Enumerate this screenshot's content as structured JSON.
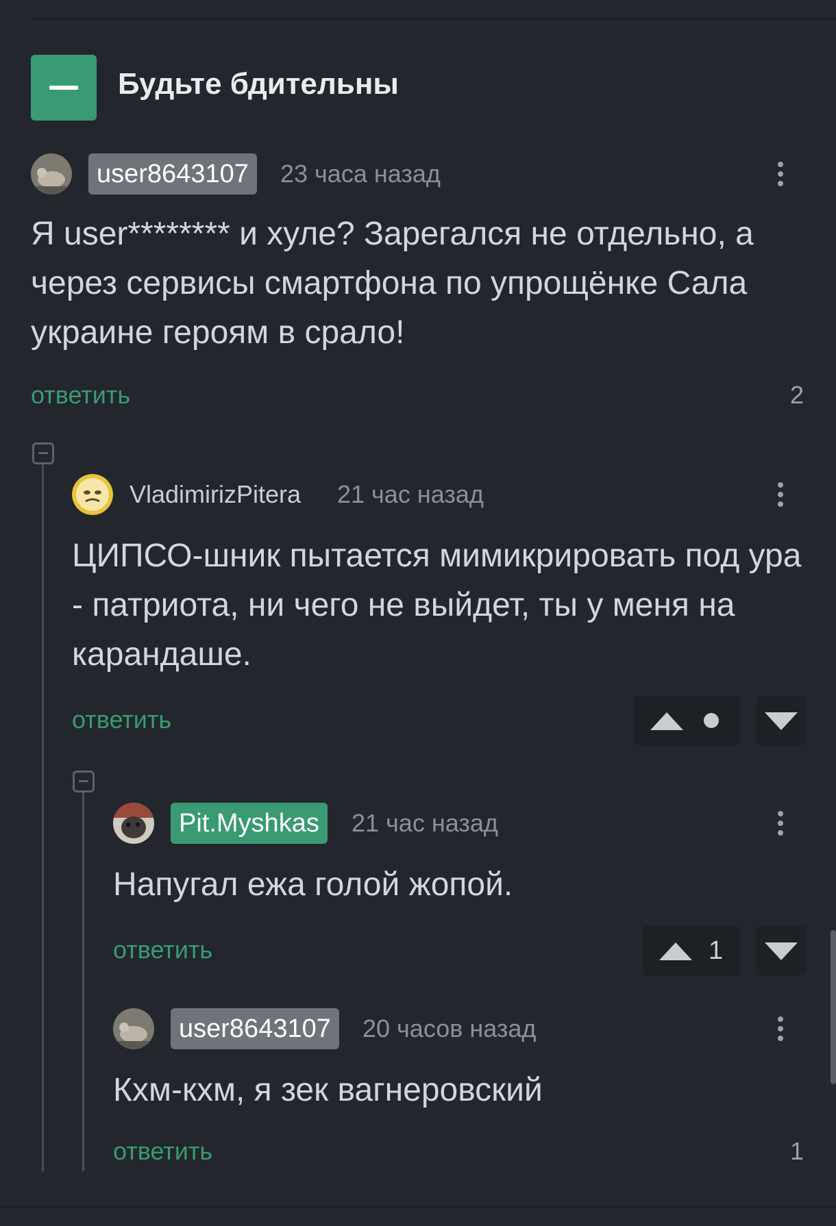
{
  "story": {
    "title": "Будьте бдительны"
  },
  "comments": [
    {
      "author": "user8643107",
      "time": "23 часа назад",
      "text": "Я user******** и хуле? Зарегался не отдельно, а через сервисы смартфона по упрощёнке Сала украине героям в срало!",
      "reply_label": "ответить",
      "count": "2"
    },
    {
      "author": "VladimirizPitera",
      "time": "21 час назад",
      "text": "ЦИПСО-шник пытается мимикрировать под ура - патриота, ни чего не выйдет, ты у меня на карандаше.",
      "reply_label": "ответить"
    },
    {
      "author": "Pit.Myshkas",
      "time": "21 час назад",
      "text": "Напугал ежа голой жопой.",
      "reply_label": "ответить",
      "rating": "1"
    },
    {
      "author": "user8643107",
      "time": "20 часов назад",
      "text": "Кхм-кхм, я зек вагнеровский",
      "reply_label": "ответить",
      "count": "1"
    }
  ],
  "colors": {
    "accent": "#3a9a73",
    "background": "#23272d",
    "nick_gray": "#6f747b"
  },
  "icons": [
    "minus-icon",
    "kebab-icon",
    "upvote-icon",
    "downvote-icon"
  ]
}
